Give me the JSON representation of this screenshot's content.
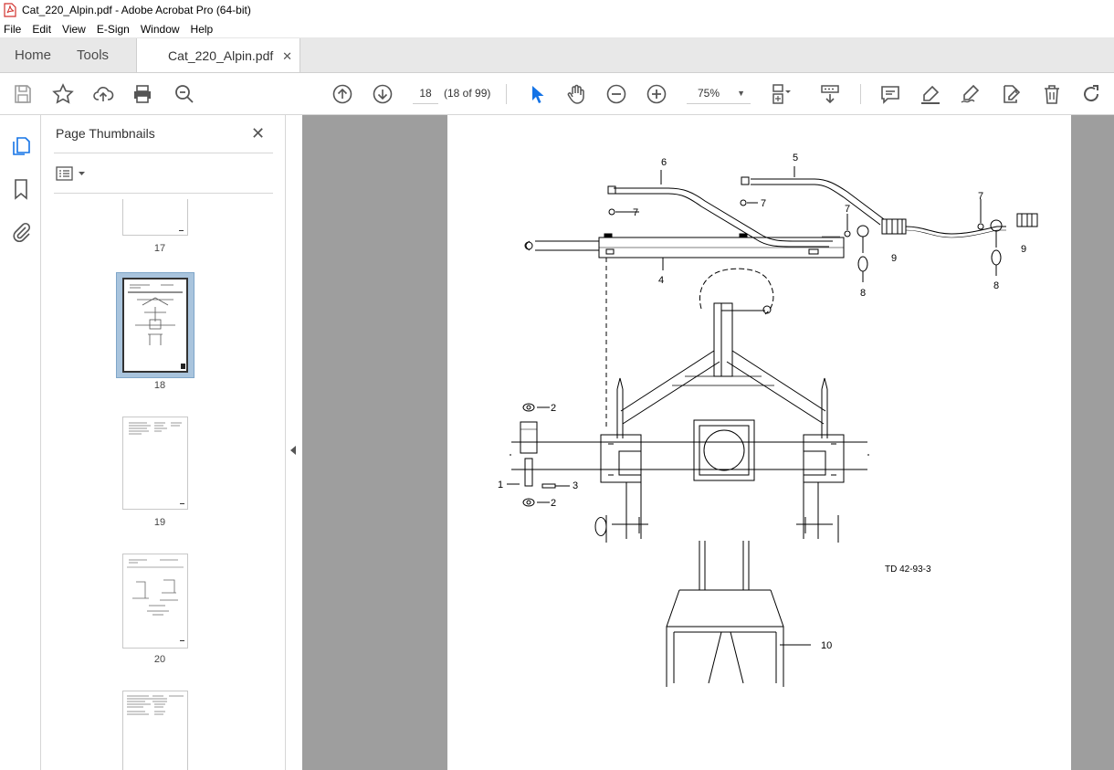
{
  "window": {
    "title": "Cat_220_Alpin.pdf - Adobe Acrobat Pro (64-bit)"
  },
  "menu": [
    "File",
    "Edit",
    "View",
    "E-Sign",
    "Window",
    "Help"
  ],
  "tabs": {
    "home": "Home",
    "tools": "Tools",
    "document": "Cat_220_Alpin.pdf"
  },
  "toolbar": {
    "page_number": "18",
    "page_count": "(18 of 99)",
    "zoom": "75%"
  },
  "sidebar": {
    "title": "Page Thumbnails",
    "thumbnails": [
      {
        "label": "17"
      },
      {
        "label": "18",
        "selected": true
      },
      {
        "label": "19"
      },
      {
        "label": "20"
      }
    ]
  },
  "drawing": {
    "callouts": [
      "1",
      "2",
      "2",
      "3",
      "4",
      "5",
      "6",
      "7",
      "7",
      "7",
      "7",
      "8",
      "8",
      "9",
      "9",
      "10"
    ],
    "reference": "TD 42-93-3"
  }
}
